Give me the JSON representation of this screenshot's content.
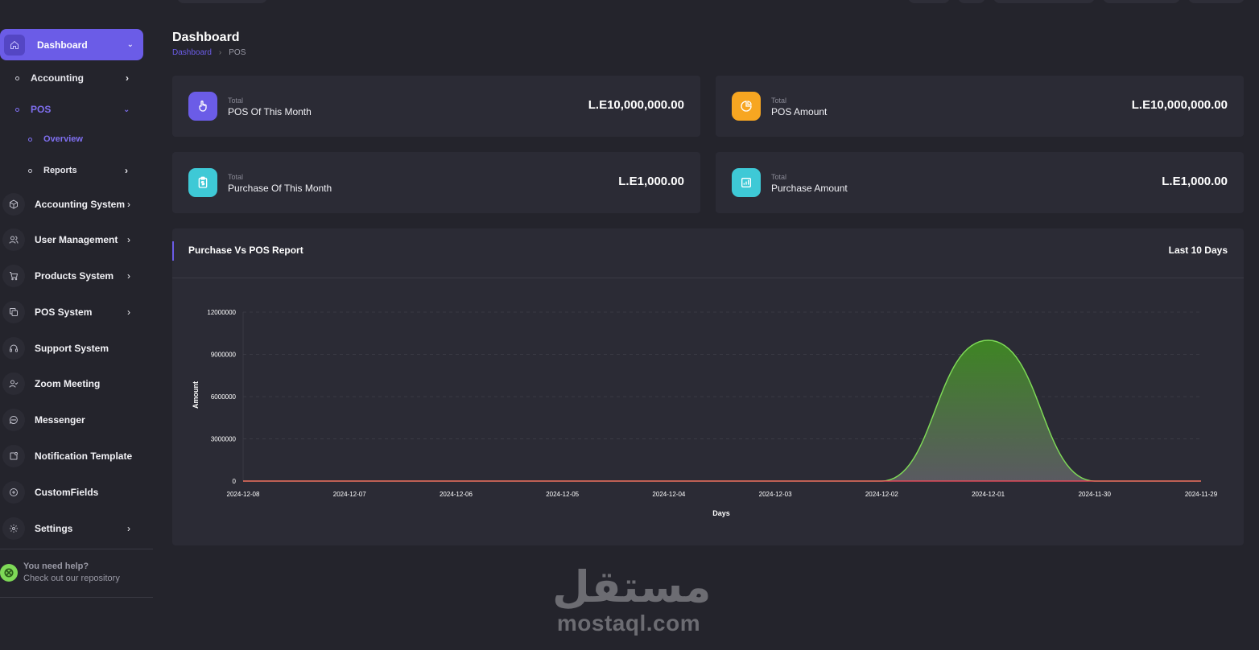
{
  "sidebar": {
    "active": {
      "label": "Dashboard",
      "icon": "home-icon"
    },
    "sub_items": [
      {
        "label": "Accounting"
      },
      {
        "label": "POS"
      },
      {
        "label": "Overview"
      },
      {
        "label": "Reports"
      }
    ],
    "items": [
      {
        "label": "Accounting System",
        "icon": "cube-icon"
      },
      {
        "label": "User Management",
        "icon": "users-icon"
      },
      {
        "label": "Products System",
        "icon": "cart-icon"
      },
      {
        "label": "POS System",
        "icon": "copy-icon"
      },
      {
        "label": "Support System",
        "icon": "headset-icon"
      },
      {
        "label": "Zoom Meeting",
        "icon": "user-check-icon"
      },
      {
        "label": "Messenger",
        "icon": "chat-icon"
      },
      {
        "label": "Notification Template",
        "icon": "notification-icon"
      },
      {
        "label": "CustomFields",
        "icon": "plus-circle-icon"
      },
      {
        "label": "Settings",
        "icon": "gear-icon"
      }
    ],
    "help": {
      "title": "You need help?",
      "subtitle": "Check out our repository"
    }
  },
  "header": {
    "title": "Dashboard",
    "breadcrumb": [
      "Dashboard",
      "POS"
    ]
  },
  "cards": [
    {
      "label_small": "Total",
      "title": "POS Of This Month",
      "value": "L.E10,000,000.00",
      "color": "#6b5ce7",
      "icon": "hand-pointer-icon"
    },
    {
      "label_small": "Total",
      "title": "POS Amount",
      "value": "L.E10,000,000.00",
      "color": "#f7a621",
      "icon": "pie-chart-icon"
    },
    {
      "label_small": "Total",
      "title": "Purchase Of This Month",
      "value": "L.E1,000.00",
      "color": "#3ec9d6",
      "icon": "clipboard-dollar-icon"
    },
    {
      "label_small": "Total",
      "title": "Purchase Amount",
      "value": "L.E1,000.00",
      "color": "#3ec9d6",
      "icon": "bar-chart-icon"
    }
  ],
  "report": {
    "title": "Purchase Vs POS Report",
    "range_label": "Last 10 Days"
  },
  "chart_data": {
    "type": "area",
    "x": [
      "2024-12-08",
      "2024-12-07",
      "2024-12-06",
      "2024-12-05",
      "2024-12-04",
      "2024-12-03",
      "2024-12-02",
      "2024-12-01",
      "2024-11-30",
      "2024-11-29"
    ],
    "series": [
      {
        "values": [
          0,
          0,
          0,
          0,
          0,
          0,
          0,
          10000000,
          0,
          0
        ],
        "color": "#7ed957"
      },
      {
        "values": [
          0,
          0,
          0,
          0,
          0,
          0,
          0,
          1000,
          0,
          0
        ],
        "color": "#ff4d5e"
      }
    ],
    "xlabel": "Days",
    "ylabel": "Amount",
    "ylim": [
      0,
      12000000
    ],
    "yticks": [
      "0",
      "3000000",
      "6000000",
      "9000000",
      "12000000"
    ],
    "ytick_values": [
      0,
      3000000,
      6000000,
      9000000,
      12000000
    ],
    "grid": true
  },
  "watermark": {
    "arabic": "مستقل",
    "latin": "mostaql.com"
  }
}
